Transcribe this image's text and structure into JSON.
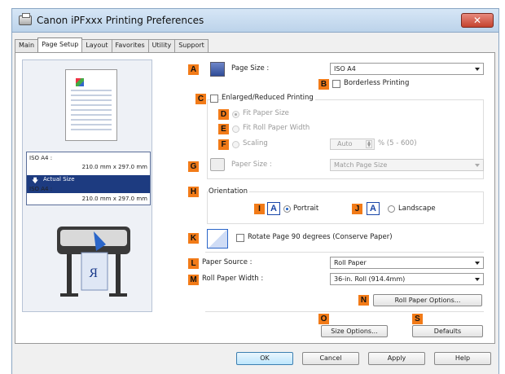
{
  "window": {
    "title": "Canon iPFxxx Printing Preferences",
    "close": "✕"
  },
  "tabs": [
    "Main",
    "Page Setup",
    "Layout",
    "Favorites",
    "Utility",
    "Support"
  ],
  "preview": {
    "size1_name": "ISO A4 :",
    "size1_dim": "210.0 mm x 297.0 mm",
    "actual_label": "Actual Size",
    "size2_name": "ISO A4 :",
    "size2_dim": "210.0 mm x 297.0 mm"
  },
  "letters": {
    "A": "A",
    "B": "B",
    "C": "C",
    "D": "D",
    "E": "E",
    "F": "F",
    "G": "G",
    "H": "H",
    "I": "I",
    "J": "J",
    "K": "K",
    "L": "L",
    "M": "M",
    "N": "N",
    "O": "O",
    "S": "S"
  },
  "settings": {
    "page_size_label": "Page Size :",
    "page_size_value": "ISO A4",
    "borderless_label": "Borderless Printing",
    "enlarged_label": "Enlarged/Reduced Printing",
    "fit_paper_size": "Fit Paper Size",
    "fit_roll_width": "Fit Roll Paper Width",
    "scaling_label": "Scaling",
    "scaling_value": "Auto",
    "scaling_range": "% (5 - 600)",
    "paper_size_label": "Paper Size :",
    "paper_size_value": "Match Page Size",
    "orientation_label": "Orientation",
    "portrait_icon": "A",
    "portrait_label": "Portrait",
    "landscape_icon": "A",
    "landscape_label": "Landscape",
    "rotate_label": "Rotate Page 90 degrees (Conserve Paper)",
    "paper_source_label": "Paper Source :",
    "paper_source_value": "Roll Paper",
    "roll_width_label": "Roll Paper Width :",
    "roll_width_value": "36-in. Roll (914.4mm)",
    "roll_options_btn": "Roll Paper Options...",
    "size_options_btn": "Size Options...",
    "defaults_btn": "Defaults"
  },
  "footer": {
    "ok": "OK",
    "cancel": "Cancel",
    "apply": "Apply",
    "help": "Help"
  }
}
